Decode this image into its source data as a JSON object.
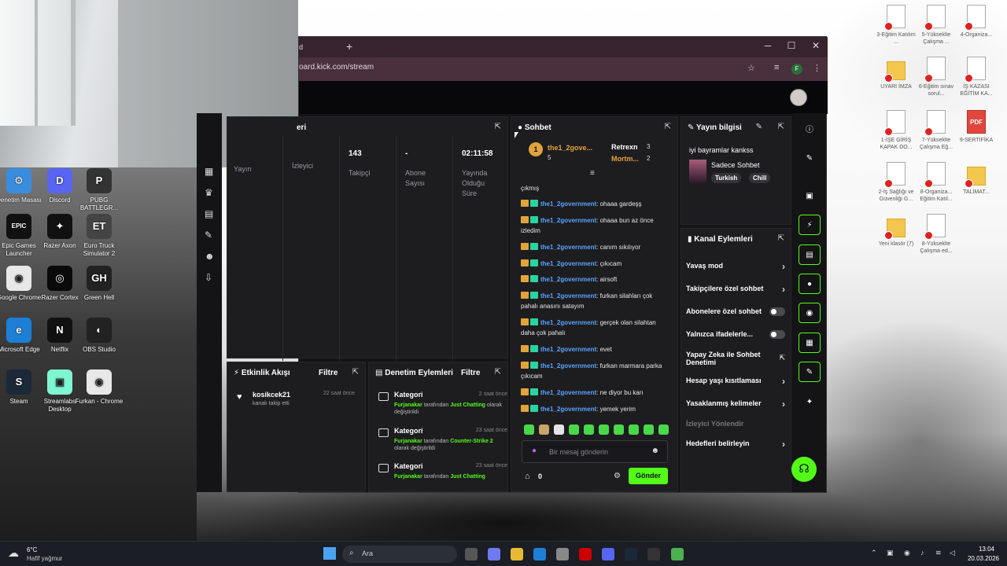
{
  "desktop_left": [
    {
      "label": "Denetim Masası",
      "color": "#3a8dde",
      "glyph": "⚙"
    },
    {
      "label": "Discord",
      "color": "#5865f2",
      "glyph": "D"
    },
    {
      "label": "PUBG BATTLEGR...",
      "color": "#333333",
      "glyph": "P"
    },
    {
      "label": "Epic Games Launcher",
      "color": "#111111",
      "glyph": "EPIC"
    },
    {
      "label": "Razer Axon",
      "color": "#111111",
      "glyph": "✦"
    },
    {
      "label": "Euro Truck Simulator 2",
      "color": "#444444",
      "glyph": "ET"
    },
    {
      "label": "Google Chrome",
      "color": "#e8e8e8",
      "glyph": "◉"
    },
    {
      "label": "Razer Cortex",
      "color": "#0a0a0a",
      "glyph": "◎"
    },
    {
      "label": "Green Hell",
      "color": "#222222",
      "glyph": "GH"
    },
    {
      "label": "Microsoft Edge",
      "color": "#1e7fd6",
      "glyph": "e"
    },
    {
      "label": "Netflix",
      "color": "#111111",
      "glyph": "N"
    },
    {
      "label": "OBS Studio",
      "color": "#222222",
      "glyph": "◐"
    },
    {
      "label": "Steam",
      "color": "#1b2838",
      "glyph": "S"
    },
    {
      "label": "Streamlabs Desktop",
      "color": "#80f5d2",
      "glyph": "▣"
    },
    {
      "label": "Furkan - Chrome",
      "color": "#e8e8e8",
      "glyph": "◉"
    }
  ],
  "desktop_right": [
    {
      "label": "3-Eğitim Katılım ...",
      "type": "doc"
    },
    {
      "label": "5-Yükseklte Çalışma ...",
      "type": "doc"
    },
    {
      "label": "4-Organiza...",
      "type": "doc"
    },
    {
      "label": "UYARI İMZA",
      "type": "folder"
    },
    {
      "label": "6-Eğitim sınav sorul...",
      "type": "doc"
    },
    {
      "label": "İŞ KAZASI EĞİTİM KA...",
      "type": "doc"
    },
    {
      "label": "1-İŞE GİRİŞ KAPAK DO...",
      "type": "doc"
    },
    {
      "label": "7-Yükseklte Çalışma Eğ...",
      "type": "doc"
    },
    {
      "label": "9-SERTİFİKA",
      "type": "pdf"
    },
    {
      "label": "2-İş Sağlığı ve Güvenliği G...",
      "type": "doc"
    },
    {
      "label": "8-Organiza... Eğitim Katıl...",
      "type": "doc"
    },
    {
      "label": "TALİMAT...",
      "type": "folder"
    },
    {
      "label": "Yeni klasör (7)",
      "type": "folder"
    },
    {
      "label": "8-Yükseklte Çalışma ed...",
      "type": "doc"
    }
  ],
  "browser": {
    "tab_partial": "d",
    "new_tab": "+",
    "url": "oard.kick.com/stream",
    "profile_letter": "F"
  },
  "stats": {
    "header_partial": "eri",
    "items": [
      {
        "value": "",
        "label": "Yayın"
      },
      {
        "value": "",
        "label": "İzleyici"
      },
      {
        "value": "143",
        "label": "Takipçi"
      },
      {
        "value": "-",
        "label": "Abone Sayısı"
      },
      {
        "value": "02:11:58",
        "label": "Yayında Olduğu Süre"
      }
    ]
  },
  "events": {
    "title": "Etkinlik Akışı",
    "filter": "Filtre",
    "items": [
      {
        "name": "kosikcek21",
        "sub": "kanalı takip etti",
        "time": "22 saat önce"
      }
    ]
  },
  "moderation": {
    "title": "Denetim Eylemleri",
    "filter": "Filtre",
    "items": [
      {
        "title": "Kategori",
        "time": "2 saat önce",
        "user": "Furjanakar",
        "mid": " tarafından ",
        "cat": "Just Chatting",
        "end": " olarak değiştirildi"
      },
      {
        "title": "Kategori",
        "time": "23 saat önce",
        "user": "Furjanakar",
        "mid": " tarafından ",
        "cat": "Counter-Strike 2",
        "end": " olarak değiştirildi"
      },
      {
        "title": "Kategori",
        "time": "23 saat önce",
        "user": "Furjanakar",
        "mid": " tarafından ",
        "cat": "Just Chatting",
        "end": ""
      }
    ]
  },
  "chat": {
    "title": "Sohbet",
    "leader": {
      "rank": "1",
      "name": "the1_2gove...",
      "count": "5"
    },
    "leader2": {
      "name": "Retrexn",
      "count": "3"
    },
    "leader3": {
      "name": "Mortm...",
      "count": "2"
    },
    "partial_top": "çıkmış",
    "messages": [
      {
        "user": "the1_2government",
        "text": "ohaaa gardeşş"
      },
      {
        "user": "the1_2government",
        "text": "ohaaa bun az önce izledim"
      },
      {
        "user": "the1_2government",
        "text": "canım sıkılıyor"
      },
      {
        "user": "the1_2government",
        "text": "çıkıcam"
      },
      {
        "user": "the1_2government",
        "text": "airsoft"
      },
      {
        "user": "the1_2government",
        "text": "furkan silahları çok pahalı anasını satayım"
      },
      {
        "user": "the1_2government",
        "text": "gerçek olan silahtan daha çok pahalı"
      },
      {
        "user": "the1_2government",
        "text": "evet"
      },
      {
        "user": "the1_2government",
        "text": "furkan marmara parka çıkıcam"
      },
      {
        "user": "the1_2government",
        "text": "ne diyor bu karı"
      },
      {
        "user": "the1_2government",
        "text": "yemek yerim"
      }
    ],
    "placeholder": "Bir mesaj gönderin",
    "points": "0",
    "send": "Gönder"
  },
  "stream_info": {
    "title": "Yayın bilgisi",
    "stream_title": "iyi bayramlar kankss",
    "category": "Sadece Sohbet",
    "tags": [
      "Turkish",
      "Chill"
    ]
  },
  "channel_actions": {
    "title": "Kanal Eylemleri",
    "items": [
      {
        "label": "Yavaş mod",
        "control": "chevron"
      },
      {
        "label": "Takipçilere özel sohbet",
        "control": "chevron"
      },
      {
        "label": "Abonelere özel sohbet",
        "control": "toggle"
      },
      {
        "label": "Yalnızca ifadelerle...",
        "control": "toggle"
      },
      {
        "label": "Yapay Zeka ile Sohbet Denetimi",
        "control": "external"
      },
      {
        "label": "Hesap yaşı kısıtlaması",
        "control": "chevron"
      },
      {
        "label": "Yasaklanmış kelimeler",
        "control": "chevron"
      },
      {
        "label": "İzleyici Yönlendir",
        "control": "none"
      },
      {
        "label": "Hedefleri belirleyin",
        "control": "chevron"
      }
    ]
  },
  "taskbar": {
    "weather_temp": "6°C",
    "weather_text": "Hafif yağmur",
    "search": "Ara",
    "time": "13:04",
    "date": "20.03.2026"
  },
  "colors": {
    "kick_green": "#53fc18",
    "panel": "#1d1d20",
    "page": "#141416",
    "chrome": "#37232e"
  }
}
